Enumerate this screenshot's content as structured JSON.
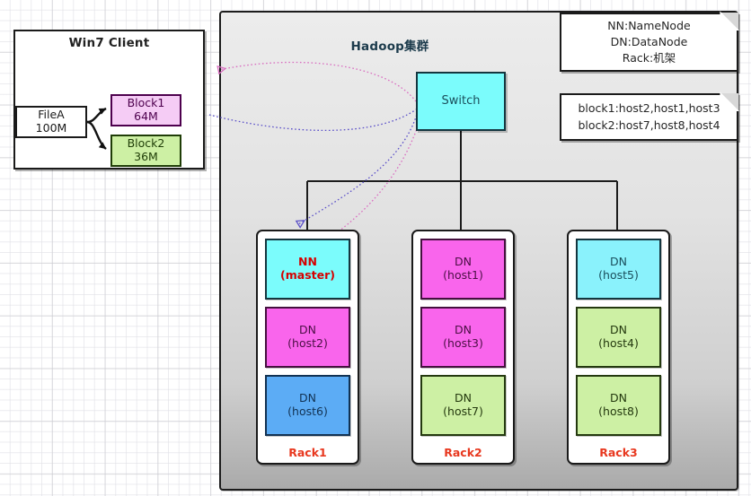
{
  "client": {
    "title": "Win7 Client",
    "file": {
      "name": "FileA",
      "size": "100M"
    },
    "blocks": [
      {
        "name": "Block1",
        "size": "64M",
        "color": "#f5ccf5"
      },
      {
        "name": "Block2",
        "size": "36M",
        "color": "#cdf0a4"
      }
    ]
  },
  "cluster": {
    "title": "Hadoop集群",
    "switch_label": "Switch",
    "switch_color": "#7bfcfc"
  },
  "notes": {
    "legend": {
      "line1": "NN:NameNode",
      "line2": "DN:DataNode",
      "line3": "Rack:机架"
    },
    "block_placement": {
      "line1": "block1:host2,host1,host3",
      "line2": "block2:host7,host8,host4"
    }
  },
  "racks": [
    {
      "label": "Rack1",
      "nodes": [
        {
          "role": "NN",
          "host": "(master)",
          "color": "#7bfcfc",
          "emphasis": true
        },
        {
          "role": "DN",
          "host": "(host2)",
          "color": "#f965ec",
          "emphasis": false
        },
        {
          "role": "DN",
          "host": "(host6)",
          "color": "#5cacf5",
          "emphasis": false
        }
      ]
    },
    {
      "label": "Rack2",
      "nodes": [
        {
          "role": "DN",
          "host": "(host1)",
          "color": "#f965ec",
          "emphasis": false
        },
        {
          "role": "DN",
          "host": "(host3)",
          "color": "#f965ec",
          "emphasis": false
        },
        {
          "role": "DN",
          "host": "(host7)",
          "color": "#cdf0a4",
          "emphasis": false
        }
      ]
    },
    {
      "label": "Rack3",
      "nodes": [
        {
          "role": "DN",
          "host": "(host5)",
          "color": "#8af2fc",
          "emphasis": false
        },
        {
          "role": "DN",
          "host": "(host4)",
          "color": "#cdf0a4",
          "emphasis": false
        },
        {
          "role": "DN",
          "host": "(host8)",
          "color": "#cdf0a4",
          "emphasis": false
        }
      ]
    }
  ],
  "connections": {
    "client_to_switch_color": "#d96ec0",
    "switch_to_namenode_color": "#6a5ad8",
    "bus_color": "#1c1c1c",
    "rack_label_color": "#e8381f"
  }
}
